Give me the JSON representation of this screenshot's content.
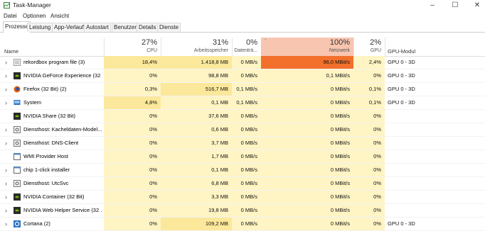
{
  "window": {
    "title": "Task-Manager"
  },
  "menu": [
    "Datei",
    "Optionen",
    "Ansicht"
  ],
  "tabs": [
    "Prozesse",
    "Leistung",
    "App-Verlauf",
    "Autostart",
    "Benutzer",
    "Details",
    "Dienste"
  ],
  "columns": {
    "name": {
      "label": "Name"
    },
    "cpu": {
      "pct": "27%",
      "label": "CPU"
    },
    "mem": {
      "pct": "31%",
      "label": "Arbeitsspeicher"
    },
    "disk": {
      "pct": "0%",
      "label": "Datenträ..."
    },
    "net": {
      "pct": "100%",
      "label": "Netzwerk"
    },
    "gpu": {
      "pct": "2%",
      "label": "GPU"
    },
    "gpumod": {
      "label": "GPU-Modul"
    }
  },
  "colors": {
    "usage_light": "#fff4c4",
    "usage_mid": "#fce89a",
    "net_header": "#f8c5b0",
    "net_hot": "#f2702c"
  },
  "processes": [
    {
      "name": "rekordbox program file (3)",
      "expandable": true,
      "icon": "rekordbox-icon",
      "cpu": "18,4%",
      "mem": "1.418,8 MB",
      "disk": "0 MB/s",
      "net": "96,0 MBit/s",
      "gpu": "2,4%",
      "gpumod": "GPU 0 - 3D"
    },
    {
      "name": "NVIDIA GeForce Experience (32 ...",
      "expandable": true,
      "icon": "nvidia-icon",
      "cpu": "0%",
      "mem": "98,8 MB",
      "disk": "0 MB/s",
      "net": "0,1 MBit/s",
      "gpu": "0%",
      "gpumod": "GPU 0 - 3D"
    },
    {
      "name": "Firefox (32 Bit) (2)",
      "expandable": true,
      "icon": "firefox-icon",
      "cpu": "0,3%",
      "mem": "516,7 MB",
      "disk": "0,1 MB/s",
      "net": "0 MBit/s",
      "gpu": "0,1%",
      "gpumod": "GPU 0 - 3D"
    },
    {
      "name": "System",
      "expandable": true,
      "icon": "system-icon",
      "cpu": "4,8%",
      "mem": "0,1 MB",
      "disk": "0,1 MB/s",
      "net": "0 MBit/s",
      "gpu": "0,1%",
      "gpumod": "GPU 0 - 3D"
    },
    {
      "name": "NVIDIA Share (32 Bit)",
      "expandable": false,
      "icon": "nvidia-icon",
      "cpu": "0%",
      "mem": "37,6 MB",
      "disk": "0 MB/s",
      "net": "0 MBit/s",
      "gpu": "0%",
      "gpumod": ""
    },
    {
      "name": "Diensthost: Kacheldaten-Model...",
      "expandable": true,
      "icon": "gear-icon",
      "cpu": "0%",
      "mem": "0,6 MB",
      "disk": "0 MB/s",
      "net": "0 MBit/s",
      "gpu": "0%",
      "gpumod": ""
    },
    {
      "name": "Diensthost: DNS-Client",
      "expandable": true,
      "icon": "gear-icon",
      "cpu": "0%",
      "mem": "3,7 MB",
      "disk": "0 MB/s",
      "net": "0 MBit/s",
      "gpu": "0%",
      "gpumod": ""
    },
    {
      "name": "WMI Provider Host",
      "expandable": false,
      "icon": "window-icon",
      "cpu": "0%",
      "mem": "1,7 MB",
      "disk": "0 MB/s",
      "net": "0 MBit/s",
      "gpu": "0%",
      "gpumod": ""
    },
    {
      "name": "chip 1-click installer",
      "expandable": true,
      "icon": "window-icon",
      "cpu": "0%",
      "mem": "0,1 MB",
      "disk": "0 MB/s",
      "net": "0 MBit/s",
      "gpu": "0%",
      "gpumod": ""
    },
    {
      "name": "Diensthost: UtcSvc",
      "expandable": true,
      "icon": "gear-icon",
      "cpu": "0%",
      "mem": "6,8 MB",
      "disk": "0 MB/s",
      "net": "0 MBit/s",
      "gpu": "0%",
      "gpumod": ""
    },
    {
      "name": "NVIDIA Container (32 Bit)",
      "expandable": true,
      "icon": "nvidia-icon",
      "cpu": "0%",
      "mem": "3,3 MB",
      "disk": "0 MB/s",
      "net": "0 MBit/s",
      "gpu": "0%",
      "gpumod": ""
    },
    {
      "name": "NVIDIA Web Helper Service (32 ...",
      "expandable": true,
      "icon": "nvidia-icon",
      "cpu": "0%",
      "mem": "19,8 MB",
      "disk": "0 MB/s",
      "net": "0 MBit/s",
      "gpu": "0%",
      "gpumod": ""
    },
    {
      "name": "Cortana (2)",
      "expandable": true,
      "icon": "cortana-icon",
      "cpu": "0%",
      "mem": "109,2 MB",
      "disk": "0 MB/s",
      "net": "0 MBit/s",
      "gpu": "0%",
      "gpumod": "GPU 0 - 3D"
    }
  ]
}
